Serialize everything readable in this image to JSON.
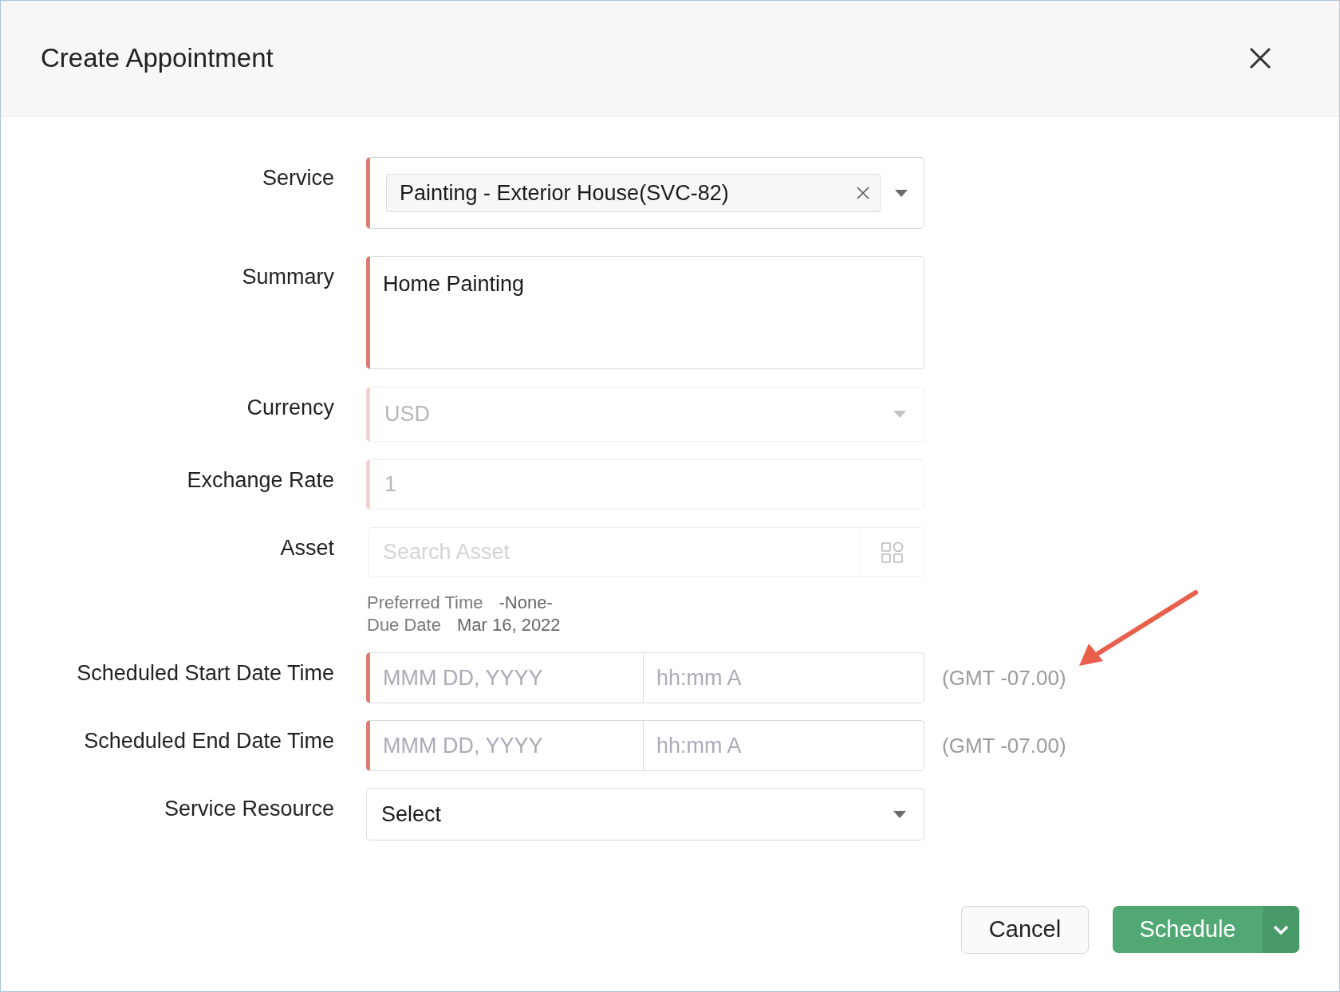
{
  "dialog": {
    "title": "Create Appointment"
  },
  "fields": [
    {
      "kind": "lookup",
      "label": "Service",
      "value": "Painting - Exterior House(SVC-82)",
      "required": true,
      "disabled": false
    },
    {
      "kind": "textarea",
      "label": "Summary",
      "value": "Home Painting",
      "required": true,
      "disabled": false
    },
    {
      "kind": "select",
      "label": "Currency",
      "value": "USD",
      "required": true,
      "disabled": true
    },
    {
      "kind": "text",
      "label": "Exchange Rate",
      "value": "1",
      "required": true,
      "disabled": true
    },
    {
      "kind": "search",
      "label": "Asset",
      "placeholder": "Search Asset",
      "required": false
    },
    {
      "kind": "info",
      "lines": [
        {
          "label": "Preferred Time",
          "value": "-None-"
        },
        {
          "label": "Due Date",
          "value": "Mar 16, 2022"
        }
      ]
    },
    {
      "kind": "datetime",
      "label": "Scheduled Start Date Time",
      "date_placeholder": "MMM DD, YYYY",
      "time_placeholder": "hh:mm A",
      "timezone": "(GMT -07.00)",
      "required": true
    },
    {
      "kind": "datetime",
      "label": "Scheduled End Date Time",
      "date_placeholder": "MMM DD, YYYY",
      "time_placeholder": "hh:mm A",
      "timezone": "(GMT -07.00)",
      "required": true
    },
    {
      "kind": "select",
      "label": "Service Resource",
      "value": "Select",
      "required": false,
      "disabled": false
    }
  ],
  "buttons": [
    {
      "kind": "secondary",
      "label": "Cancel"
    },
    {
      "kind": "primary",
      "label": "Schedule",
      "menu": true
    }
  ]
}
